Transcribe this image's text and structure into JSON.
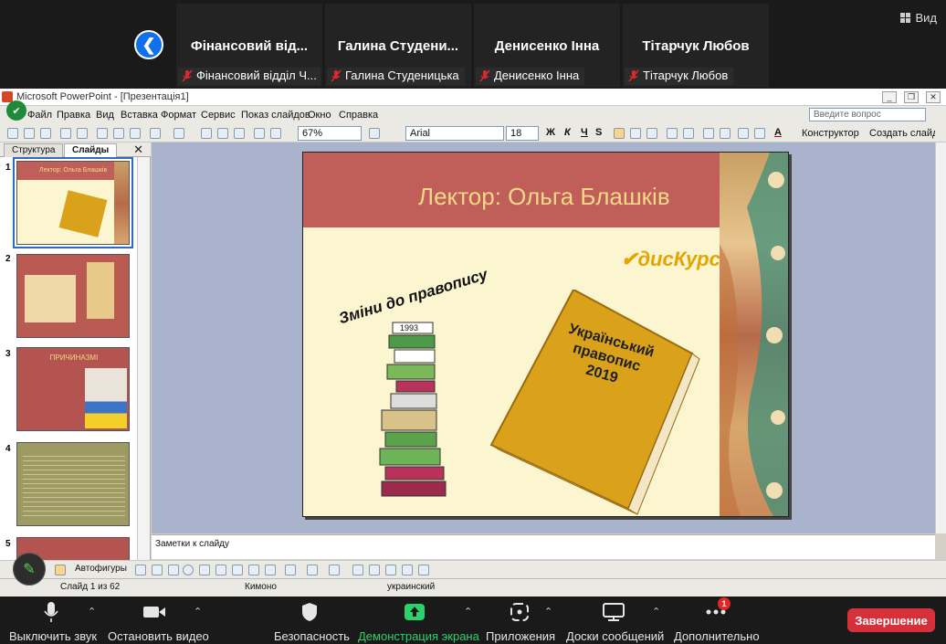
{
  "zoom": {
    "participants": [
      {
        "name": "Фінансовий від...",
        "label": "Фінансовий відділ Ч..."
      },
      {
        "name": "Галина Студени...",
        "label": "Галина Студеницька"
      },
      {
        "name": "Денисенко Інна",
        "label": "Денисенко Інна"
      },
      {
        "name": "Тітарчук Любов",
        "label": "Тітарчук Любов"
      }
    ],
    "view_label": "Вид",
    "controls": {
      "mute": "Выключить звук",
      "stop_video": "Остановить видео",
      "security": "Безопасность",
      "share": "Демонстрация экрана",
      "apps": "Приложения",
      "whiteboards": "Доски сообщений",
      "more": "Дополнительно",
      "more_badge": "1",
      "end": "Завершение"
    },
    "colors": {
      "share_green": "#2bd26b",
      "end_red": "#d6313b",
      "accent_blue": "#0e71eb"
    }
  },
  "ppt": {
    "title": "Microsoft PowerPoint - [Презентація1]",
    "menu": [
      "Файл",
      "Правка",
      "Вид",
      "Вставка",
      "Формат",
      "Сервис",
      "Показ слайдов",
      "Окно",
      "Справка"
    ],
    "ask_placeholder": "Введите вопрос",
    "toolbar": {
      "zoom": "67%",
      "font": "Arial",
      "size": "18",
      "designer": "Конструктор",
      "new_slide": "Создать слайд"
    },
    "panel_tabs": {
      "outline": "Структура",
      "slides": "Слайды"
    },
    "thumbnails": [
      {
        "num": "1",
        "title": "Лектор: Ольга Блашків"
      },
      {
        "num": "2",
        "title": ""
      },
      {
        "num": "3",
        "title": "ПРИЧИНАЗМІ"
      },
      {
        "num": "4",
        "title": ""
      },
      {
        "num": "5",
        "title": ""
      }
    ],
    "slide": {
      "title": "Лектор: Ольга Блашків",
      "logo": "дисКурс",
      "caption": "Зміни до правопису",
      "book_title": "Український\nправопис\n2019",
      "stack_year": "1993"
    },
    "notes_placeholder": "Заметки к слайду",
    "draw_toolbar": {
      "autoshapes": "Автофигуры"
    },
    "status": {
      "slide_of": "Слайд 1 из 62",
      "design": "Кимоно",
      "language": "украинский"
    }
  }
}
